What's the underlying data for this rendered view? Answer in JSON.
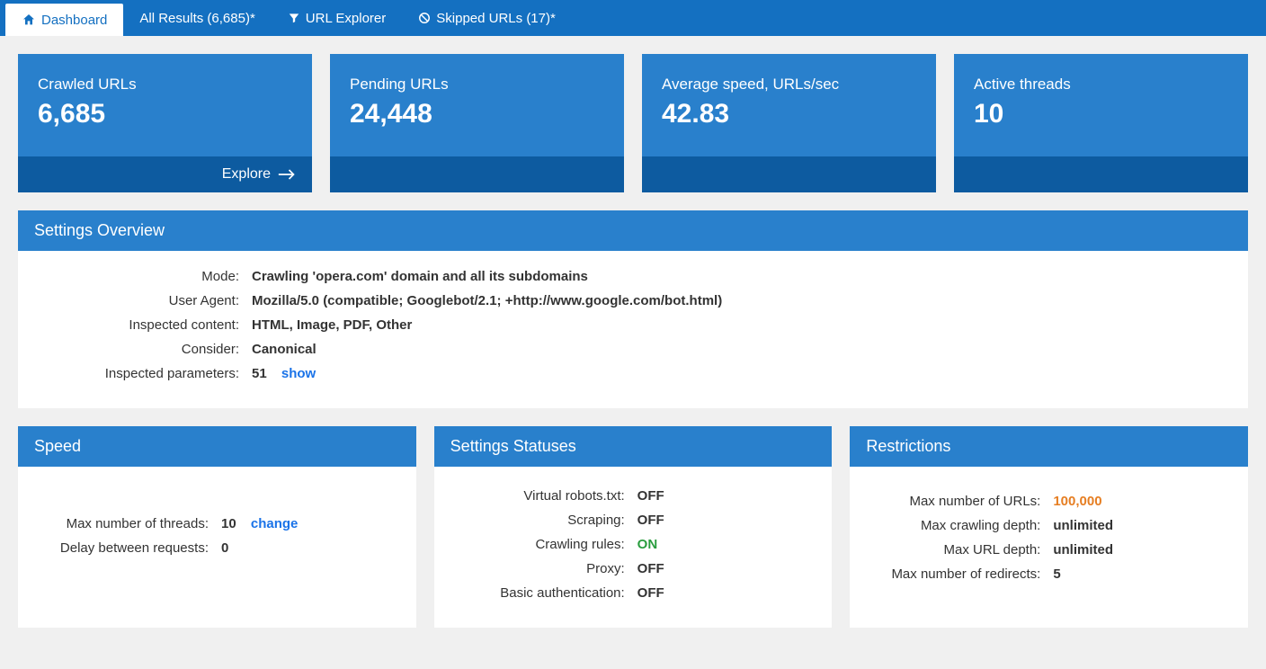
{
  "tabs": {
    "dashboard": "Dashboard",
    "all_results": "All Results (6,685)*",
    "url_explorer": "URL Explorer",
    "skipped": "Skipped URLs (17)*"
  },
  "cards": {
    "crawled": {
      "title": "Crawled URLs",
      "value": "6,685",
      "action": "Explore"
    },
    "pending": {
      "title": "Pending URLs",
      "value": "24,448"
    },
    "speed": {
      "title": "Average speed, URLs/sec",
      "value": "42.83"
    },
    "threads": {
      "title": "Active threads",
      "value": "10"
    }
  },
  "settings_overview": {
    "title": "Settings Overview",
    "rows": {
      "mode": {
        "label": "Mode:",
        "value": "Crawling 'opera.com' domain and all its subdomains"
      },
      "ua": {
        "label": "User Agent:",
        "value": "Mozilla/5.0 (compatible; Googlebot/2.1; +http://www.google.com/bot.html)"
      },
      "content": {
        "label": "Inspected content:",
        "value": "HTML, Image, PDF, Other"
      },
      "consider": {
        "label": "Consider:",
        "value": "Canonical"
      },
      "params": {
        "label": "Inspected parameters:",
        "value": "51",
        "link": "show"
      }
    }
  },
  "speed_panel": {
    "title": "Speed",
    "rows": {
      "threads": {
        "label": "Max number of threads:",
        "value": "10",
        "link": "change"
      },
      "delay": {
        "label": "Delay between requests:",
        "value": "0"
      }
    }
  },
  "statuses_panel": {
    "title": "Settings Statuses",
    "rows": {
      "robots": {
        "label": "Virtual robots.txt:",
        "value": "OFF"
      },
      "scraping": {
        "label": "Scraping:",
        "value": "OFF"
      },
      "rules": {
        "label": "Crawling rules:",
        "value": "ON"
      },
      "proxy": {
        "label": "Proxy:",
        "value": "OFF"
      },
      "auth": {
        "label": "Basic authentication:",
        "value": "OFF"
      }
    }
  },
  "restrictions_panel": {
    "title": "Restrictions",
    "rows": {
      "max_urls": {
        "label": "Max number of URLs:",
        "value": "100,000"
      },
      "crawl_depth": {
        "label": "Max crawling depth:",
        "value": "unlimited"
      },
      "url_depth": {
        "label": "Max URL depth:",
        "value": "unlimited"
      },
      "redirects": {
        "label": "Max number of redirects:",
        "value": "5"
      }
    }
  }
}
